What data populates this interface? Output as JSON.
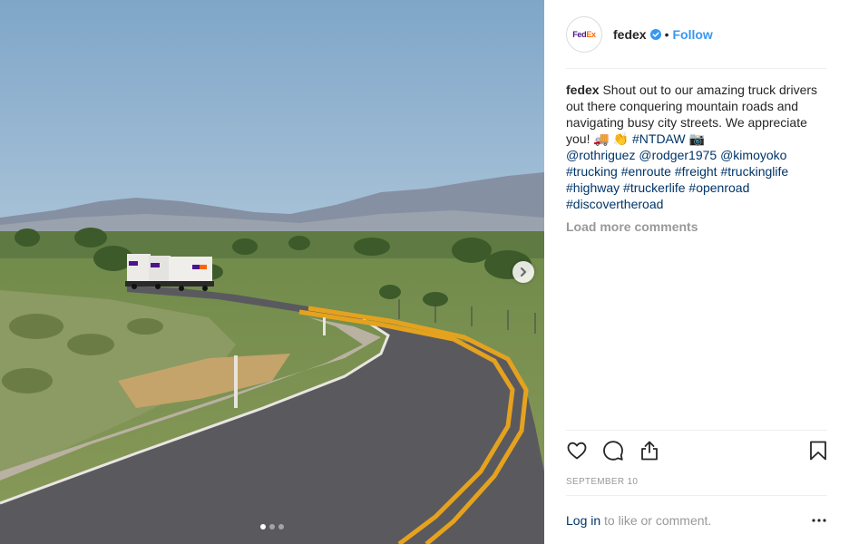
{
  "post": {
    "username": "fedex",
    "follow_label": "Follow",
    "separator": "•",
    "avatar_logo": {
      "left": "Fed",
      "right": "Ex"
    }
  },
  "caption": {
    "user": "fedex",
    "text": "Shout out to our amazing truck drivers out there conquering mountain roads and navigating busy city streets. We appreciate you! 🚚 👏",
    "hashtag_ntdaw": "#NTDAW",
    "camera_emoji": "📷",
    "mentions": [
      "@rothriguez",
      "@rodger1975",
      "@kimoyoko"
    ],
    "hashtags": [
      "#trucking",
      "#enroute",
      "#freight",
      "#truckinglife",
      "#highway",
      "#truckerlife",
      "#openroad",
      "#discovertheroad"
    ]
  },
  "comments": {
    "load_more": "Load more comments"
  },
  "meta": {
    "date": "SEPTEMBER 10"
  },
  "footer": {
    "login_link": "Log in",
    "login_rest": " to like or comment."
  },
  "carousel": {
    "total": 3,
    "active_index": 0
  },
  "colors": {
    "link": "#003569",
    "follow": "#3897f0",
    "verified": "#3897f0",
    "muted": "#999999"
  },
  "icons": [
    "heart-icon",
    "comment-icon",
    "share-icon",
    "bookmark-icon",
    "more-options-icon",
    "chevron-right-icon",
    "verified-badge-icon"
  ]
}
